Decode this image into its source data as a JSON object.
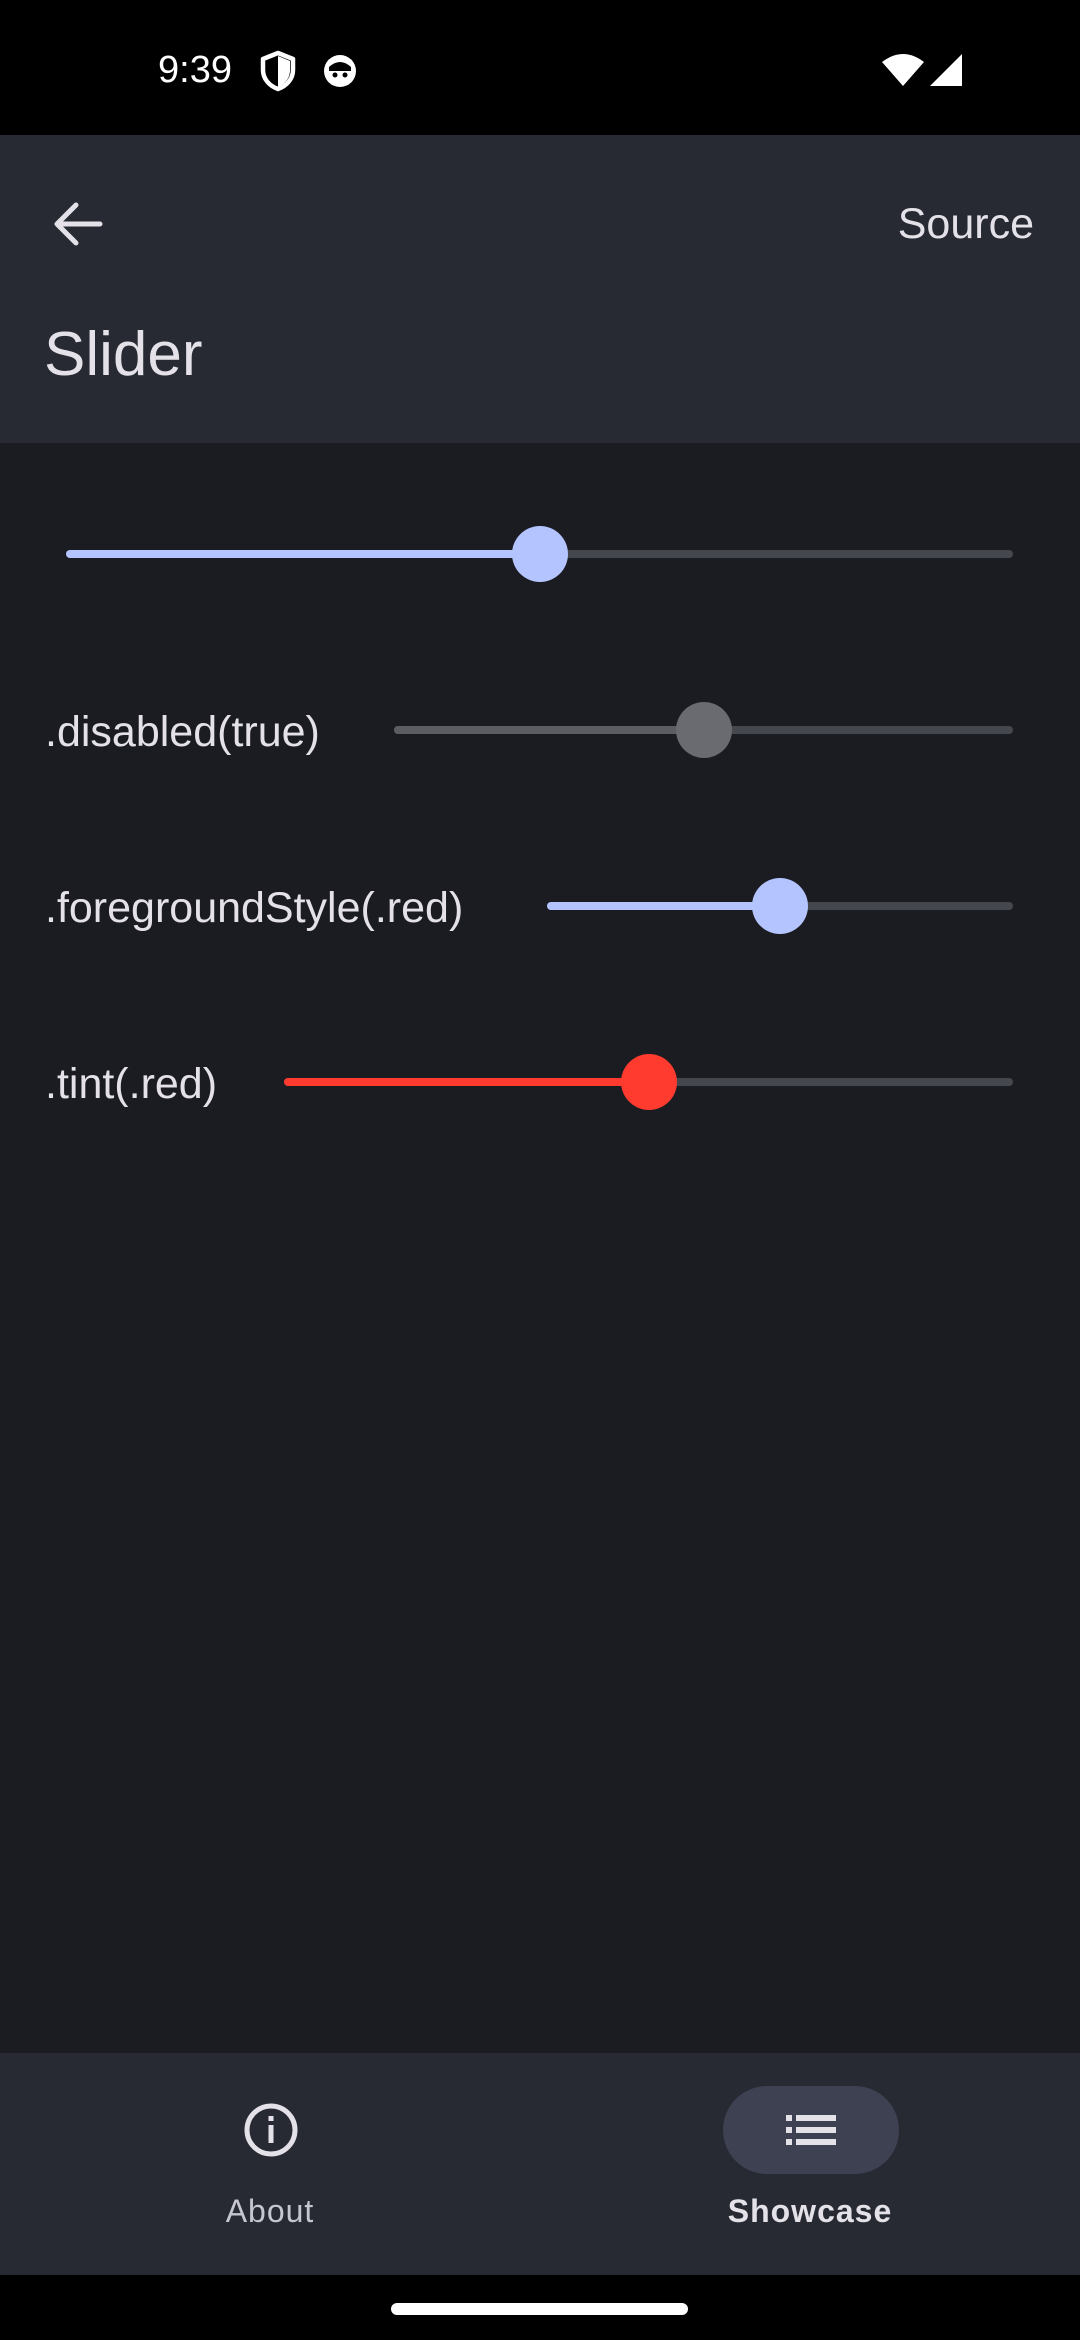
{
  "status_bar": {
    "time": "9:39",
    "icons": [
      "shield-icon",
      "face-icon",
      "wifi-icon",
      "signal-icon"
    ]
  },
  "app_bar": {
    "back_icon": "arrow-left-icon",
    "source_label": "Source",
    "title": "Slider"
  },
  "sliders": [
    {
      "label": "",
      "value": 0.5,
      "style": "default"
    },
    {
      "label": ".disabled(true)",
      "value": 0.5,
      "style": "disabled"
    },
    {
      "label": ".foregroundStyle(.red)",
      "value": 0.5,
      "style": "default"
    },
    {
      "label": ".tint(.red)",
      "value": 0.5,
      "style": "red"
    }
  ],
  "colors": {
    "accent": "#b3c4ff",
    "disabled_fill": "#5c5d63",
    "disabled_thumb": "#6a6b70",
    "red": "#ff3b30",
    "track_inactive": "#45474f",
    "nav_indicator": "#3d4152"
  },
  "bottom_nav": {
    "items": [
      {
        "label": "About",
        "icon": "info-icon",
        "selected": false
      },
      {
        "label": "Showcase",
        "icon": "list-icon",
        "selected": true
      }
    ]
  }
}
